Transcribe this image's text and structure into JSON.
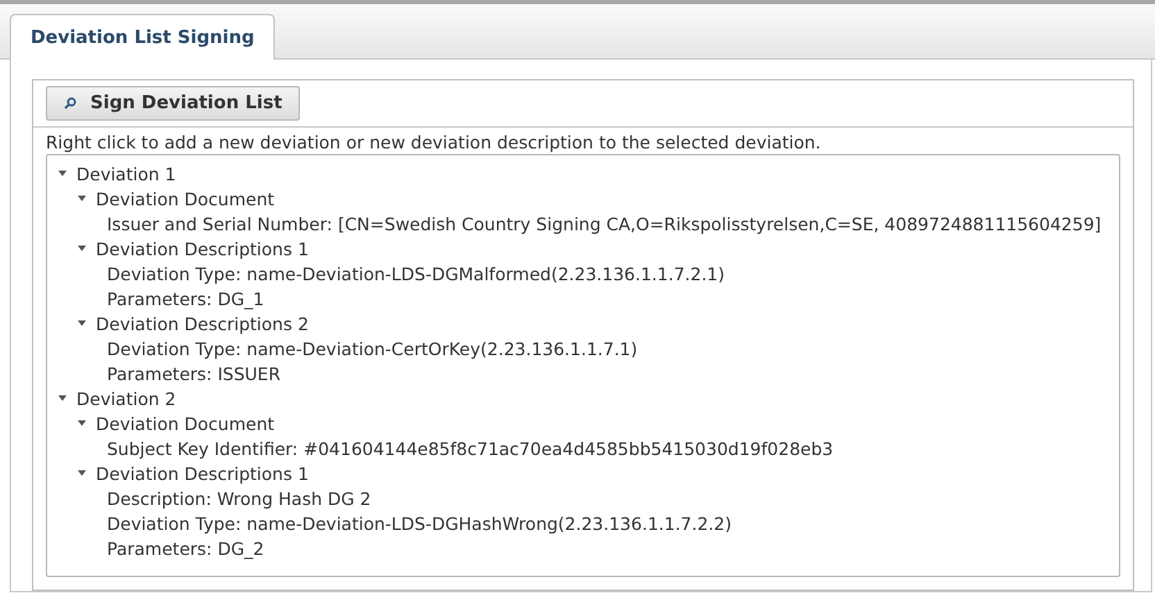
{
  "tabs": [
    {
      "label": "Deviation List Signing",
      "selected": true
    }
  ],
  "toolbar": {
    "sign_button": "Sign Deviation List"
  },
  "hint": "Right click to add a new deviation or new deviation description to the selected deviation.",
  "tree": [
    {
      "label": "Deviation 1",
      "expanded": true,
      "children": [
        {
          "label": "Deviation Document",
          "expanded": true,
          "children": [
            {
              "label": "Issuer and Serial Number: [CN=Swedish Country Signing CA,O=Rikspolisstyrelsen,C=SE, 4089724881115604259]"
            }
          ]
        },
        {
          "label": "Deviation Descriptions 1",
          "expanded": true,
          "children": [
            {
              "label": "Deviation Type: name-Deviation-LDS-DGMalformed(2.23.136.1.1.7.2.1)"
            },
            {
              "label": "Parameters: DG_1"
            }
          ]
        },
        {
          "label": "Deviation Descriptions 2",
          "expanded": true,
          "children": [
            {
              "label": "Deviation Type: name-Deviation-CertOrKey(2.23.136.1.1.7.1)"
            },
            {
              "label": "Parameters: ISSUER"
            }
          ]
        }
      ]
    },
    {
      "label": "Deviation 2",
      "expanded": true,
      "children": [
        {
          "label": "Deviation Document",
          "expanded": true,
          "children": [
            {
              "label": "Subject Key Identifier: #041604144e85f8c71ac70ea4d4585bb5415030d19f028eb3"
            }
          ]
        },
        {
          "label": "Deviation Descriptions 1",
          "expanded": true,
          "children": [
            {
              "label": "Description: Wrong Hash DG 2"
            },
            {
              "label": "Deviation Type: name-Deviation-LDS-DGHashWrong(2.23.136.1.1.7.2.2)"
            },
            {
              "label": "Parameters: DG_2"
            }
          ]
        }
      ]
    }
  ]
}
